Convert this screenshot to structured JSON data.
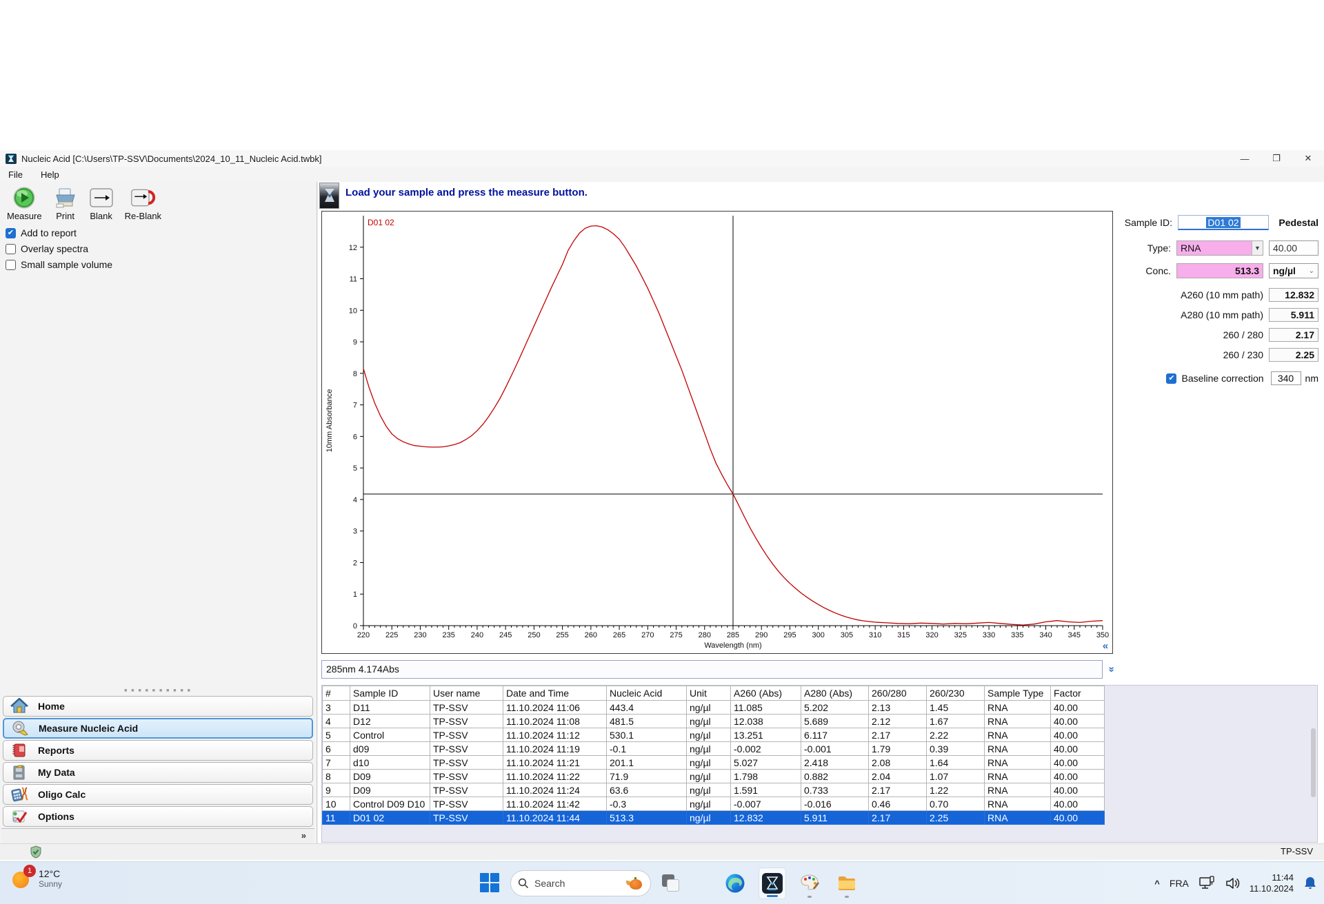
{
  "window": {
    "title": "Nucleic Acid  [C:\\Users\\TP-SSV\\Documents\\2024_10_11_Nucleic Acid.twbk]",
    "menu": [
      {
        "label": "File"
      },
      {
        "label": "Help"
      }
    ],
    "controls": {
      "minimize": "—",
      "restore": "❐",
      "close": "✕"
    }
  },
  "toolbar": {
    "buttons": [
      {
        "label": "Measure"
      },
      {
        "label": "Print"
      },
      {
        "label": "Blank"
      },
      {
        "label": "Re-Blank"
      }
    ]
  },
  "checkboxes": [
    {
      "label": "Add to report",
      "checked": true
    },
    {
      "label": "Overlay spectra",
      "checked": false
    },
    {
      "label": "Small sample volume",
      "checked": false
    }
  ],
  "sidebar": {
    "items": [
      {
        "label": "Home",
        "selected": false
      },
      {
        "label": "Measure Nucleic Acid",
        "selected": true
      },
      {
        "label": "Reports",
        "selected": false
      },
      {
        "label": "My Data",
        "selected": false
      },
      {
        "label": "Oligo Calc",
        "selected": false
      },
      {
        "label": "Options",
        "selected": false
      }
    ],
    "footer_glyph": "»"
  },
  "message": "Load your sample and press the measure button.",
  "chart_data": {
    "type": "line",
    "title": "D01 02",
    "xlabel": "Wavelength (nm)",
    "ylabel": "10mm Absorbance",
    "xlim": [
      220,
      350
    ],
    "ylim": [
      0,
      13
    ],
    "xtick_step": 5,
    "ytick_step": 1,
    "grid": false,
    "crosshair": {
      "x": 285,
      "y": 4.174
    },
    "series": [
      {
        "name": "D01 02",
        "color": "#c00000",
        "points": [
          [
            220,
            8.15
          ],
          [
            221,
            7.55
          ],
          [
            222,
            7.05
          ],
          [
            223,
            6.65
          ],
          [
            224,
            6.32
          ],
          [
            225,
            6.08
          ],
          [
            226,
            5.93
          ],
          [
            227,
            5.83
          ],
          [
            228,
            5.76
          ],
          [
            229,
            5.71
          ],
          [
            230,
            5.69
          ],
          [
            231,
            5.67
          ],
          [
            232,
            5.66
          ],
          [
            233,
            5.66
          ],
          [
            234,
            5.67
          ],
          [
            235,
            5.7
          ],
          [
            236,
            5.74
          ],
          [
            237,
            5.8
          ],
          [
            238,
            5.9
          ],
          [
            239,
            6.02
          ],
          [
            240,
            6.18
          ],
          [
            241,
            6.38
          ],
          [
            242,
            6.62
          ],
          [
            243,
            6.9
          ],
          [
            244,
            7.2
          ],
          [
            245,
            7.55
          ],
          [
            246,
            7.92
          ],
          [
            247,
            8.3
          ],
          [
            248,
            8.7
          ],
          [
            249,
            9.1
          ],
          [
            250,
            9.5
          ],
          [
            251,
            9.9
          ],
          [
            252,
            10.3
          ],
          [
            253,
            10.7
          ],
          [
            254,
            11.08
          ],
          [
            255,
            11.45
          ],
          [
            256,
            11.9
          ],
          [
            257,
            12.2
          ],
          [
            258,
            12.45
          ],
          [
            259,
            12.6
          ],
          [
            260,
            12.67
          ],
          [
            261,
            12.68
          ],
          [
            262,
            12.64
          ],
          [
            263,
            12.55
          ],
          [
            264,
            12.42
          ],
          [
            265,
            12.25
          ],
          [
            266,
            12.0
          ],
          [
            267,
            11.7
          ],
          [
            268,
            11.4
          ],
          [
            269,
            11.05
          ],
          [
            270,
            10.7
          ],
          [
            271,
            10.3
          ],
          [
            272,
            9.9
          ],
          [
            273,
            9.45
          ],
          [
            274,
            9.0
          ],
          [
            275,
            8.55
          ],
          [
            276,
            8.1
          ],
          [
            277,
            7.6
          ],
          [
            278,
            7.1
          ],
          [
            279,
            6.6
          ],
          [
            280,
            6.1
          ],
          [
            281,
            5.6
          ],
          [
            282,
            5.15
          ],
          [
            283,
            4.8
          ],
          [
            284,
            4.47
          ],
          [
            285,
            4.174
          ],
          [
            286,
            3.82
          ],
          [
            287,
            3.45
          ],
          [
            288,
            3.1
          ],
          [
            289,
            2.78
          ],
          [
            290,
            2.48
          ],
          [
            291,
            2.2
          ],
          [
            292,
            1.95
          ],
          [
            293,
            1.72
          ],
          [
            294,
            1.52
          ],
          [
            295,
            1.34
          ],
          [
            296,
            1.18
          ],
          [
            297,
            1.03
          ],
          [
            298,
            0.9
          ],
          [
            299,
            0.78
          ],
          [
            300,
            0.67
          ],
          [
            301,
            0.57
          ],
          [
            302,
            0.48
          ],
          [
            303,
            0.4
          ],
          [
            304,
            0.33
          ],
          [
            305,
            0.27
          ],
          [
            306,
            0.22
          ],
          [
            307,
            0.18
          ],
          [
            308,
            0.15
          ],
          [
            310,
            0.11
          ],
          [
            312,
            0.09
          ],
          [
            314,
            0.07
          ],
          [
            316,
            0.06
          ],
          [
            318,
            0.08
          ],
          [
            320,
            0.07
          ],
          [
            322,
            0.05
          ],
          [
            324,
            0.07
          ],
          [
            326,
            0.06
          ],
          [
            328,
            0.08
          ],
          [
            330,
            0.1
          ],
          [
            332,
            0.07
          ],
          [
            334,
            0.04
          ],
          [
            336,
            0.02
          ],
          [
            338,
            0.05
          ],
          [
            340,
            0.12
          ],
          [
            342,
            0.16
          ],
          [
            344,
            0.12
          ],
          [
            346,
            0.1
          ],
          [
            348,
            0.14
          ],
          [
            350,
            0.16
          ]
        ]
      }
    ]
  },
  "collapse_glyph": "«",
  "status_line": "285nm 4.174Abs",
  "panel": {
    "sample_id_label": "Sample ID:",
    "sample_id": "D01 02",
    "mode": "Pedestal",
    "type_label": "Type:",
    "type_value": "RNA",
    "type_factor": "40.00",
    "conc_label": "Conc.",
    "conc_value": "513.3",
    "conc_unit": "ng/µl",
    "metrics": [
      {
        "label": "A260 (10 mm path)",
        "value": "12.832"
      },
      {
        "label": "A280 (10 mm path)",
        "value": "5.911"
      },
      {
        "label": "260 / 280",
        "value": "2.17"
      },
      {
        "label": "260 / 230",
        "value": "2.25"
      }
    ],
    "baseline_label": "Baseline correction",
    "baseline_checked": true,
    "baseline_value": "340",
    "baseline_unit": "nm",
    "accent_pink": "#f7aeeb",
    "selection_blue": "#1565d8"
  },
  "table": {
    "columns": [
      "#",
      "Sample ID",
      "User name",
      "Date and Time",
      "Nucleic Acid",
      "Unit",
      "A260 (Abs)",
      "A280 (Abs)",
      "260/280",
      "260/230",
      "Sample Type",
      "Factor"
    ],
    "rows": [
      [
        "3",
        "D11",
        "TP-SSV",
        "11.10.2024 11:06",
        "443.4",
        "ng/µl",
        "11.085",
        "5.202",
        "2.13",
        "1.45",
        "RNA",
        "40.00"
      ],
      [
        "4",
        "D12",
        "TP-SSV",
        "11.10.2024 11:08",
        "481.5",
        "ng/µl",
        "12.038",
        "5.689",
        "2.12",
        "1.67",
        "RNA",
        "40.00"
      ],
      [
        "5",
        "Control",
        "TP-SSV",
        "11.10.2024 11:12",
        "530.1",
        "ng/µl",
        "13.251",
        "6.117",
        "2.17",
        "2.22",
        "RNA",
        "40.00"
      ],
      [
        "6",
        "d09",
        "TP-SSV",
        "11.10.2024 11:19",
        "-0.1",
        "ng/µl",
        "-0.002",
        "-0.001",
        "1.79",
        "0.39",
        "RNA",
        "40.00"
      ],
      [
        "7",
        "d10",
        "TP-SSV",
        "11.10.2024 11:21",
        "201.1",
        "ng/µl",
        "5.027",
        "2.418",
        "2.08",
        "1.64",
        "RNA",
        "40.00"
      ],
      [
        "8",
        "D09",
        "TP-SSV",
        "11.10.2024 11:22",
        "71.9",
        "ng/µl",
        "1.798",
        "0.882",
        "2.04",
        "1.07",
        "RNA",
        "40.00"
      ],
      [
        "9",
        "D09",
        "TP-SSV",
        "11.10.2024 11:24",
        "63.6",
        "ng/µl",
        "1.591",
        "0.733",
        "2.17",
        "1.22",
        "RNA",
        "40.00"
      ],
      [
        "10",
        "Control D09 D10",
        "TP-SSV",
        "11.10.2024 11:42",
        "-0.3",
        "ng/µl",
        "-0.007",
        "-0.016",
        "0.46",
        "0.70",
        "RNA",
        "40.00"
      ],
      [
        "11",
        "D01 02",
        "TP-SSV",
        "11.10.2024 11:44",
        "513.3",
        "ng/µl",
        "12.832",
        "5.911",
        "2.17",
        "2.25",
        "RNA",
        "40.00"
      ]
    ],
    "selected_row_number": "11"
  },
  "app_statusbar": {
    "user": "TP-SSV"
  },
  "taskbar": {
    "weather": {
      "badge": "1",
      "temp": "12°C",
      "desc": "Sunny"
    },
    "search_label": "Search",
    "tray": {
      "chevron": "^",
      "language": "FRA",
      "time": "11:44",
      "date": "11.10.2024"
    }
  }
}
